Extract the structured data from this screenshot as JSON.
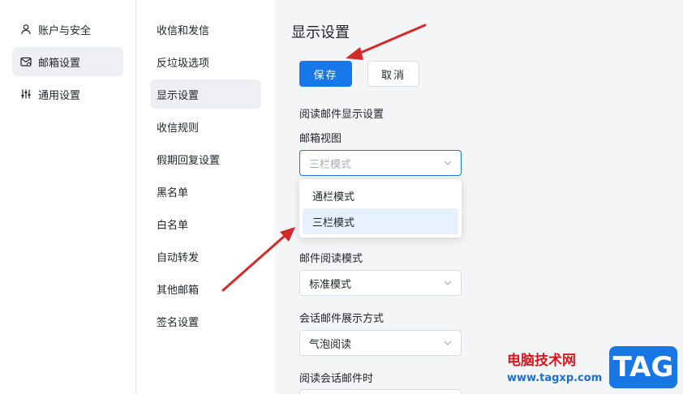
{
  "left_nav": {
    "items": [
      {
        "label": "账户与安全",
        "icon": "user-icon"
      },
      {
        "label": "邮箱设置",
        "icon": "mailbox-settings-icon",
        "active": true
      },
      {
        "label": "通用设置",
        "icon": "sliders-icon"
      }
    ]
  },
  "sub_nav": {
    "items": [
      {
        "label": "收信和发信"
      },
      {
        "label": "反垃圾选项"
      },
      {
        "label": "显示设置",
        "active": true
      },
      {
        "label": "收信规则"
      },
      {
        "label": "假期回复设置"
      },
      {
        "label": "黑名单"
      },
      {
        "label": "白名单"
      },
      {
        "label": "自动转发"
      },
      {
        "label": "其他邮箱"
      },
      {
        "label": "签名设置"
      }
    ]
  },
  "main": {
    "title": "显示设置",
    "save_label": "保存",
    "cancel_label": "取消",
    "section_read_display": "阅读邮件显示设置",
    "mailbox_view": {
      "label": "邮箱视图",
      "placeholder": "三栏模式",
      "options": [
        "通栏模式",
        "三栏模式"
      ],
      "selected": "三栏模式"
    },
    "read_mode": {
      "label": "邮件阅读模式",
      "value": "标准模式"
    },
    "conversation_display": {
      "label": "会话邮件展示方式",
      "value": "气泡阅读"
    },
    "conversation_reading": {
      "label": "阅读会话邮件时"
    }
  },
  "colors": {
    "accent": "#1778ea",
    "annotation_arrow": "#d42a2a",
    "active_bg": "#edeff2",
    "option_selected_bg": "#e6f1fd"
  },
  "watermark": {
    "site_name": "电脑技术网",
    "url": "www.tagxp.com",
    "badge": "TAG"
  }
}
